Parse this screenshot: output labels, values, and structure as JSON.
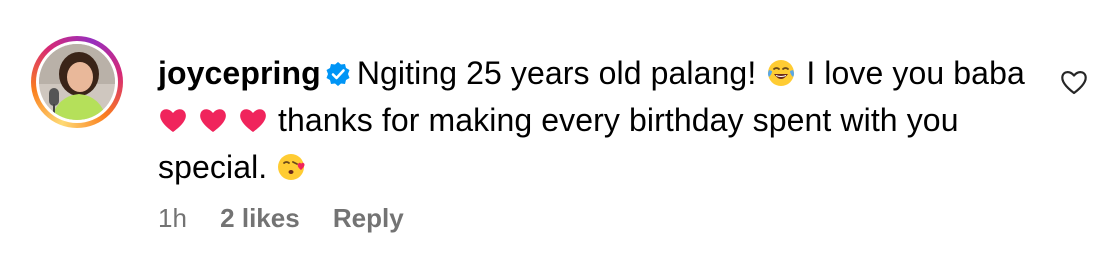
{
  "comment": {
    "username": "joycepring",
    "verified_icon": "verified-badge-icon",
    "text_part1": "Ngiting 25 years old palang!",
    "text_part2": "I love you baba",
    "text_part3": "thanks for making every birthday spent with you special.",
    "emojis": [
      "face-with-tears-of-joy",
      "red-heart",
      "red-heart",
      "red-heart",
      "face-blowing-a-kiss"
    ]
  },
  "meta": {
    "time": "1h",
    "likes": "2 likes",
    "reply_label": "Reply"
  },
  "like_icon": "heart-outline-icon",
  "colors": {
    "verified": "#0095f6",
    "meta_text": "#737373",
    "heart": "#f0245c"
  }
}
